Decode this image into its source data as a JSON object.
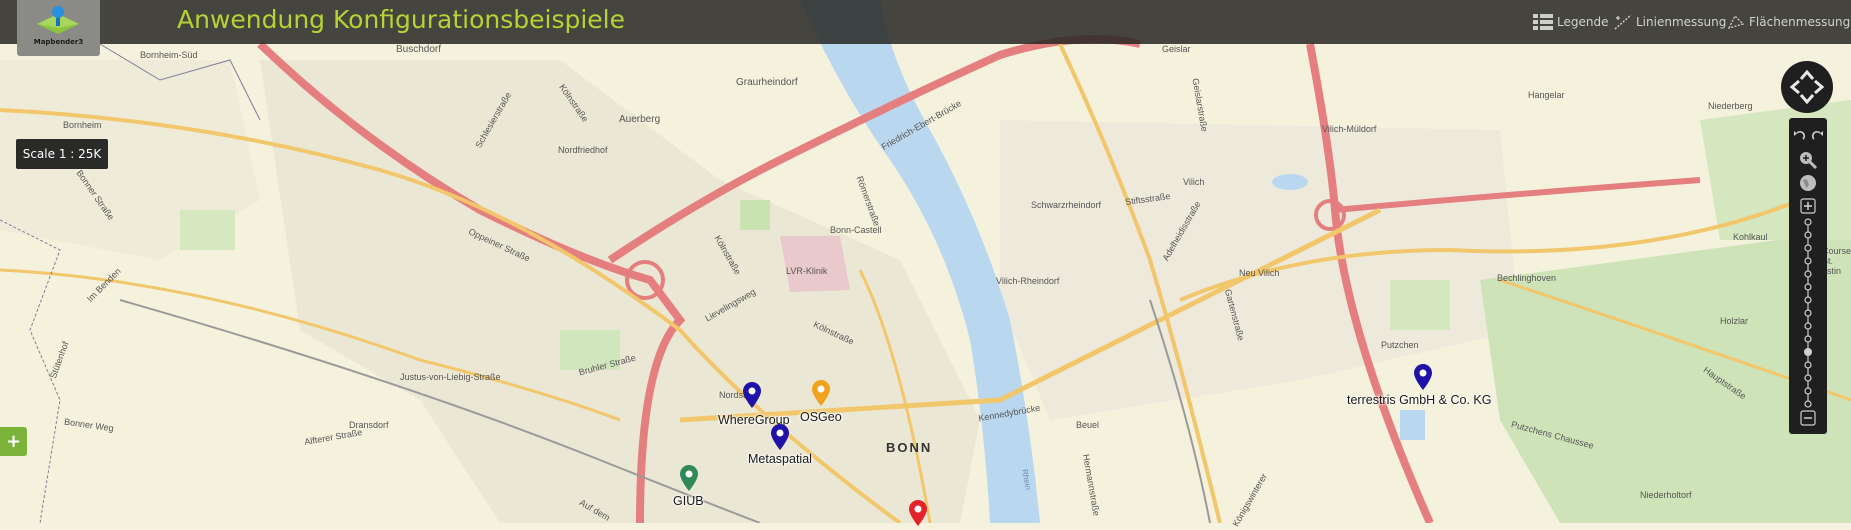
{
  "app": {
    "title": "Anwendung Konfigurationsbeispiele",
    "logo_text": "Mapbender3"
  },
  "toolbar": {
    "legend_label": "Legende",
    "line_measure_label": "Linienmessung",
    "area_measure_label": "Flächenmessung"
  },
  "scale": {
    "text": "Scale 1 : 25K"
  },
  "colors": {
    "title_green": "#b5d334",
    "river": "#b9d8f0",
    "motorway": "#e57f7f",
    "main_road": "#f2c66b",
    "marker_blue": "#1e12a8",
    "marker_orange": "#f0a41e",
    "marker_green": "#2f8a58",
    "marker_red": "#e3232a"
  },
  "markers": [
    {
      "label": "WhereGroup",
      "color": "blue"
    },
    {
      "label": "OSGeo",
      "color": "orange"
    },
    {
      "label": "Metaspatial",
      "color": "blue"
    },
    {
      "label": "GIUB",
      "color": "green"
    },
    {
      "label": "terrestris GmbH & Co. KG",
      "color": "blue"
    },
    {
      "label": "",
      "color": "red"
    }
  ],
  "map_labels": {
    "bonn": "BONN",
    "buschdorf": "Buschdorf",
    "bornheim_sud": "Bornheim-Süd",
    "bornheim": "Bornheim",
    "graurheindorf": "Graurheindorf",
    "auerberg": "Auerberg",
    "nordfriedhof": "Nordfriedhof",
    "lvr": "LVR-Klinik",
    "bonn_castell": "Bonn-Castell",
    "koelnstr_1": "Kölnstraße",
    "koelnstr_2": "Kölnstraße",
    "koelnstr_3": "Kölnstraße",
    "lievelingsweg": "Lievelingsweg",
    "bruhler": "Bruhler Straße",
    "oppeiner": "Oppeiner Straße",
    "justus": "Justus-von-Liebig-Straße",
    "dransdorf": "Dransdorf",
    "bonner_weg": "Bonner Weg",
    "alfterer": "Alfterer Straße",
    "im_benden": "Im Benden",
    "stuetenhof": "Stütenhof",
    "bonner_str": "Bonner Straße",
    "schlesier": "Schlesierstraße",
    "nordst": "Nordst",
    "geislar": "Geislar",
    "geislarstr": "Geislarstraße",
    "vilich_muldorf": "Vilich-Müldorf",
    "vilich": "Vilich",
    "hangelar": "Hangelar",
    "niederberg": "Niederberg",
    "schwarzrheindorf": "Schwarzrheindorf",
    "stiftsstrasse": "Stiftsstraße",
    "vilich_rheindorf": "Vilich-Rheindorf",
    "adelheidis": "Adelheidisstraße",
    "neu_vilich": "Neu Vilich",
    "gartenstrasse": "Gartenstraße",
    "bechlinghoven": "Bechlinghoven",
    "kohlkaul": "Kohlkaul",
    "putzchen": "Putzchen",
    "holzlar": "Holzlar",
    "hauptstrasse": "Hauptstraße",
    "beuel": "Beuel",
    "kennedy": "Kennedybrücke",
    "hermann": "Hermannstraße",
    "putzchens_ch": "Putzchens Chaussee",
    "niederholtorf": "Niederholtorf",
    "friedrich": "Friedrich-Ebert-Brücke",
    "koenigswinterer": "Königswinterer",
    "roemer": "Römerstraße",
    "aufdem": "Auf dem",
    "rhein": "Rhein",
    "course": "Course\nSt.\nustin"
  }
}
